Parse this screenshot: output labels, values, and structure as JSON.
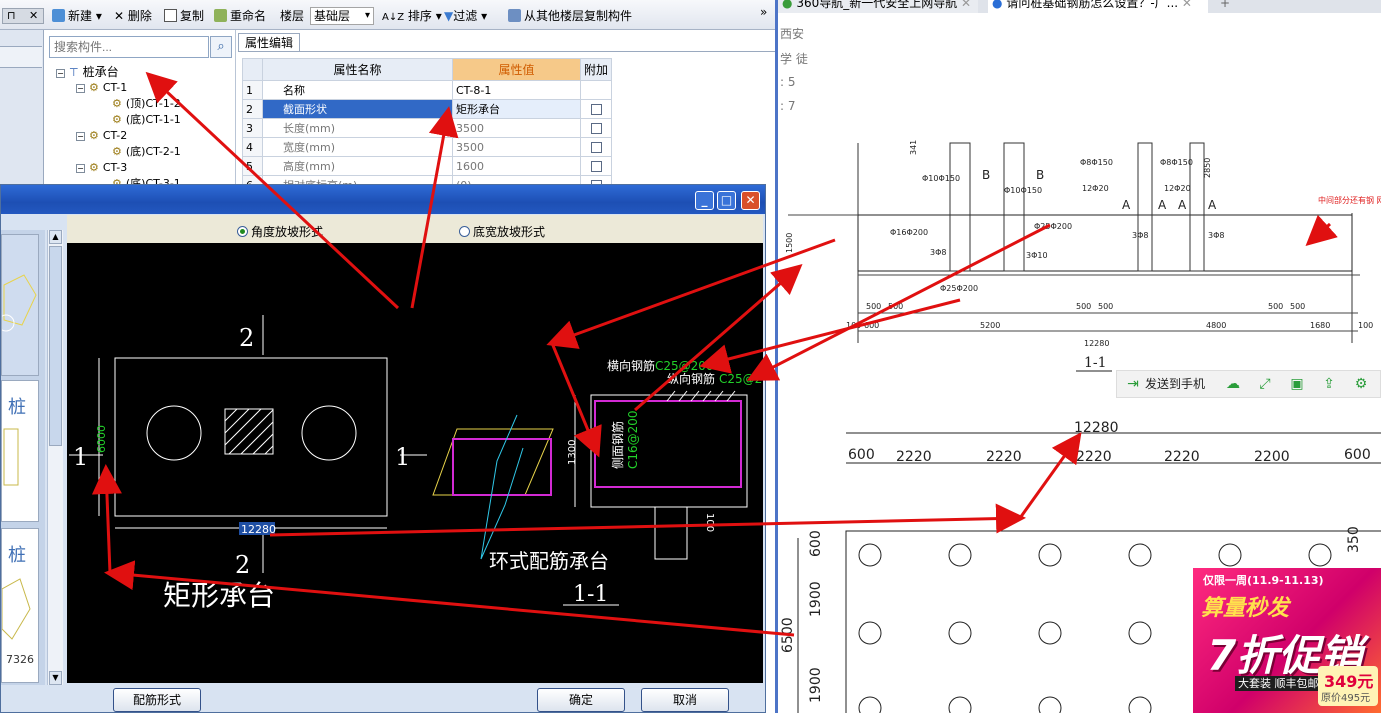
{
  "toolbar": {
    "new_label": "新建",
    "delete_label": "删除",
    "copy_label": "复制",
    "rename_label": "重命名",
    "floor_label": "楼层",
    "floor_value": "基础层",
    "sort_label": "排序",
    "filter_label": "过滤",
    "copy_from_floor_label": "从其他楼层复制构件",
    "overflow": "»"
  },
  "tree": {
    "search_placeholder": "搜索构件...",
    "items": [
      {
        "label": "桩承台",
        "level": 0
      },
      {
        "label": "CT-1",
        "level": 1
      },
      {
        "label": "(顶)CT-1-2",
        "level": 2
      },
      {
        "label": "(底)CT-1-1",
        "level": 2
      },
      {
        "label": "CT-2",
        "level": 1
      },
      {
        "label": "(底)CT-2-1",
        "level": 2
      },
      {
        "label": "CT-3",
        "level": 1
      },
      {
        "label": "(底)CT-3-1",
        "level": 2
      }
    ]
  },
  "property_panel": {
    "tab_label": "属性编辑",
    "headers": {
      "name": "属性名称",
      "value": "属性值",
      "extra": "附加"
    },
    "rows": [
      {
        "num": "1",
        "name": "名称",
        "value": "CT-8-1",
        "has_check": false
      },
      {
        "num": "2",
        "name": "截面形状",
        "value": "矩形承台",
        "has_check": true
      },
      {
        "num": "3",
        "name": "长度(mm)",
        "value": "3500",
        "has_check": true
      },
      {
        "num": "4",
        "name": "宽度(mm)",
        "value": "3500",
        "has_check": true
      },
      {
        "num": "5",
        "name": "高度(mm)",
        "value": "1600",
        "has_check": true
      },
      {
        "num": "6",
        "name": "相对底标高(m)",
        "value": "(0)",
        "has_check": true
      }
    ]
  },
  "dialog": {
    "radio_angle": "角度放坡形式",
    "radio_width": "底宽放坡形式",
    "rebar_form_button": "配筋形式",
    "ok_button": "确定",
    "cancel_button": "取消",
    "thumb_labels": [
      "桩",
      "桩"
    ],
    "thumb_number": "7326",
    "drawing": {
      "section_mark_top": "2",
      "section_mark_bottom": "2",
      "section_mark_left": "1",
      "section_mark_right": "1",
      "dim_height": "6000",
      "dim_length": "12280",
      "caption_left": "矩形承台",
      "caption_right": "环式配筋承台",
      "caption_section": "1-1",
      "rebar_transverse": "横向钢筋",
      "rebar_transverse_spec": "C25@200",
      "rebar_longitudinal": "纵向钢筋",
      "rebar_longitudinal_spec": "C25@20",
      "rebar_side": "侧面钢筋",
      "rebar_side_spec": "C16@200",
      "dim_section_height": "1300",
      "dim_bottom": "100"
    }
  },
  "browser": {
    "tabs": [
      {
        "title": "360导航_新一代安全上网导航",
        "active": false
      },
      {
        "title": "请问桩基础钢筋怎么设置？-广...",
        "active": true
      }
    ],
    "new_tab": "+",
    "side_text": [
      "西安",
      "学 徒",
      ": 5",
      ": 7"
    ],
    "drawing1": {
      "labels": [
        "Φ10Φ150",
        "Φ10Φ150",
        "Φ8Φ150",
        "Φ8Φ150",
        "12Φ20",
        "12Φ20",
        "Φ16Φ200",
        "Φ25Φ200",
        "Φ25Φ200",
        "3Φ8",
        "3Φ8",
        "3Φ8",
        "3Φ10"
      ],
      "dims": [
        "500",
        "500",
        "500",
        "500",
        "500",
        "500",
        "600",
        "5200",
        "4800",
        "1680",
        "100",
        "100",
        "1500",
        "2850",
        "341"
      ],
      "total": "12280",
      "section": "1-1",
      "marks": [
        "B",
        "B",
        "A",
        "A",
        "A",
        "A"
      ],
      "note_red": "中间部分还有钢\n网，应该何设置"
    },
    "send_bar": {
      "send_label": "发送到手机"
    },
    "drawing2": {
      "total": "12280",
      "spans": [
        "600",
        "2220",
        "2220",
        "2220",
        "2220",
        "2200",
        "600"
      ],
      "vdims": [
        "600",
        "1900",
        "1900",
        "6500",
        "350"
      ]
    },
    "ad": {
      "line1": "仅限一周(11.9-11.13)",
      "line2": "算量秒发",
      "line3": "7折促销",
      "tag": "大套装\n顺丰包邮",
      "price": "349元",
      "orig_price": "原价495元"
    }
  }
}
